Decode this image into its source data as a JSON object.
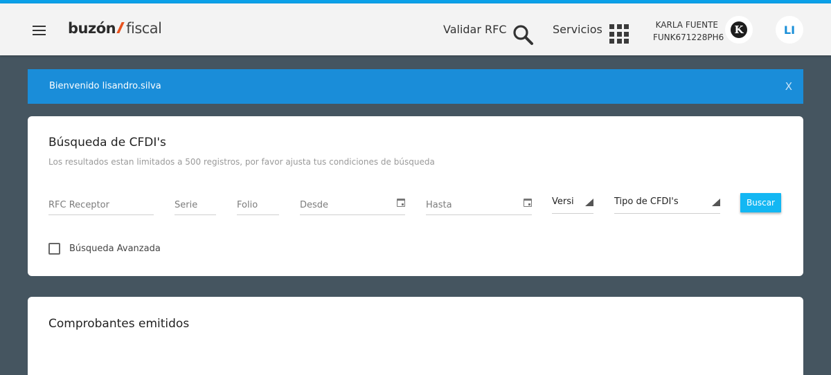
{
  "header": {
    "logo_brand": "buzón",
    "logo_product": "fiscal",
    "validar_rfc": "Validar RFC",
    "servicios": "Servicios",
    "user_name": "KARLA FUENTE",
    "user_rfc": "FUNK671228PH6",
    "company_avatar_letter": "K",
    "user_initials": "LI"
  },
  "banner": {
    "message": "Bienvenido lisandro.silva",
    "close_label": "X"
  },
  "search": {
    "title": "Búsqueda de CFDI's",
    "subtitle": "Los resultados estan limitados a 500 registros, por favor ajusta tus condiciones de búsqueda",
    "fields": {
      "rfc_receptor": "RFC Receptor",
      "serie": "Serie",
      "folio": "Folio",
      "desde": "Desde",
      "hasta": "Hasta"
    },
    "version_select": "Versi",
    "tipo_select": "Tipo de CFDI's",
    "buscar_button": "Buscar",
    "advanced_label": "Búsqueda Avanzada"
  },
  "emitidos": {
    "title": "Comprobantes emitidos"
  },
  "colors": {
    "accent": "#0aa0e8",
    "banner": "#1a8dd9",
    "button": "#13b7f3",
    "background": "#455560",
    "logo_slash": "#e8531f"
  }
}
